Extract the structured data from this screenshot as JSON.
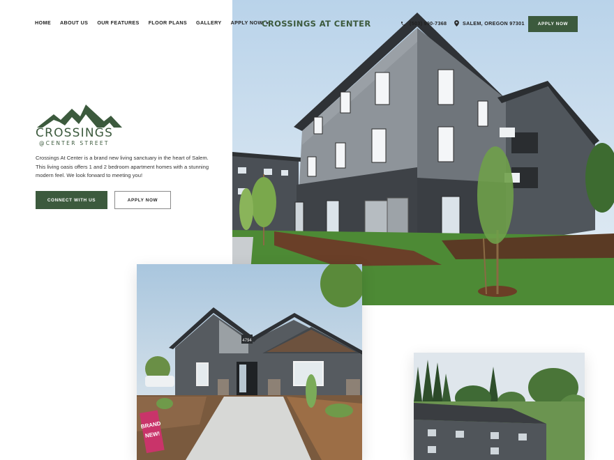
{
  "nav": {
    "items": [
      {
        "label": "HOME"
      },
      {
        "label": "ABOUT US"
      },
      {
        "label": "OUR FEATURES"
      },
      {
        "label": "FLOOR PLANS"
      },
      {
        "label": "GALLERY"
      },
      {
        "label": "APPLY NOW",
        "has_dropdown": true
      }
    ]
  },
  "header": {
    "title": "CROSSINGS AT CENTER",
    "phone": "(503) 990-7368",
    "address": "SALEM, OREGON 97301",
    "apply_label": "APPLY NOW",
    "phone_icon": "phone-icon",
    "address_icon": "map-pin-icon"
  },
  "logo": {
    "word": "CROSSINGS",
    "sub": "@CENTER STREET",
    "icon": "mountain-icon"
  },
  "intro": {
    "text": "Crossings At Center is a brand new living sanctuary in the heart of Salem. This living oasis offers 1 and 2 bedroom apartment homes with a stunning modern feel. We look forward to meeting you!"
  },
  "cta": {
    "primary": "CONNECT WITH US",
    "secondary": "APPLY NOW"
  },
  "photos": {
    "leasing_office_number": "4794",
    "sign_text_1": "BRAND",
    "sign_text_2": "NEW!"
  },
  "colors": {
    "brand_green": "#3c5a3d",
    "siding_gray": "#8e949a",
    "siding_dark": "#3e4247",
    "sky": "#cfe0ef",
    "lawn": "#4d8a35"
  }
}
